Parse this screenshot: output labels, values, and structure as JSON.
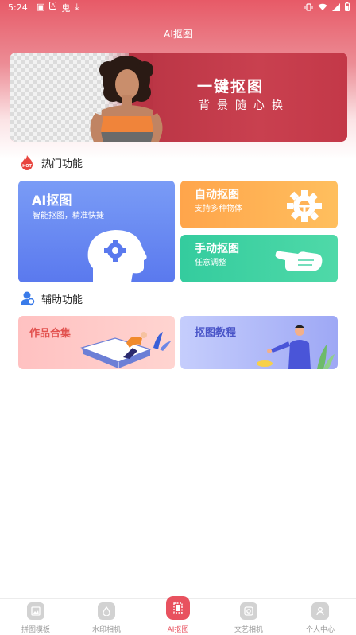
{
  "status_bar": {
    "time": "5:24",
    "left_icons": [
      "▣",
      "A",
      "鬼",
      "⤓"
    ]
  },
  "app": {
    "title": "AI抠图"
  },
  "banner": {
    "title": "一键抠图",
    "subtitle": "背景随心换"
  },
  "sections": {
    "hot": {
      "label": "热门功能",
      "icon_text": "HOT"
    },
    "aux": {
      "label": "辅助功能"
    }
  },
  "cards": {
    "ai": {
      "title": "AI抠图",
      "subtitle": "智能抠图，精准快捷"
    },
    "auto": {
      "title": "自动抠图",
      "subtitle": "支持多种物体"
    },
    "manual": {
      "title": "手动抠图",
      "subtitle": "任意调整"
    },
    "works": {
      "title": "作品合集"
    },
    "tutorial": {
      "title": "抠图教程"
    }
  },
  "tabbar": {
    "active": "AI抠图",
    "tabs": [
      {
        "label": "拼图模板",
        "icon": "image-icon"
      },
      {
        "label": "水印相机",
        "icon": "drop-icon"
      },
      {
        "label": "AI抠图",
        "icon": "cutout-icon"
      },
      {
        "label": "文艺相机",
        "icon": "camera-icon"
      },
      {
        "label": "个人中心",
        "icon": "person-icon"
      }
    ]
  },
  "colors": {
    "primary": "#e8525f",
    "ai_card": "#6a8af2",
    "auto_card": "#ffae52",
    "manual_card": "#3fd2a3",
    "works_card": "#ffcaca",
    "tutorial_card": "#b5befa"
  }
}
